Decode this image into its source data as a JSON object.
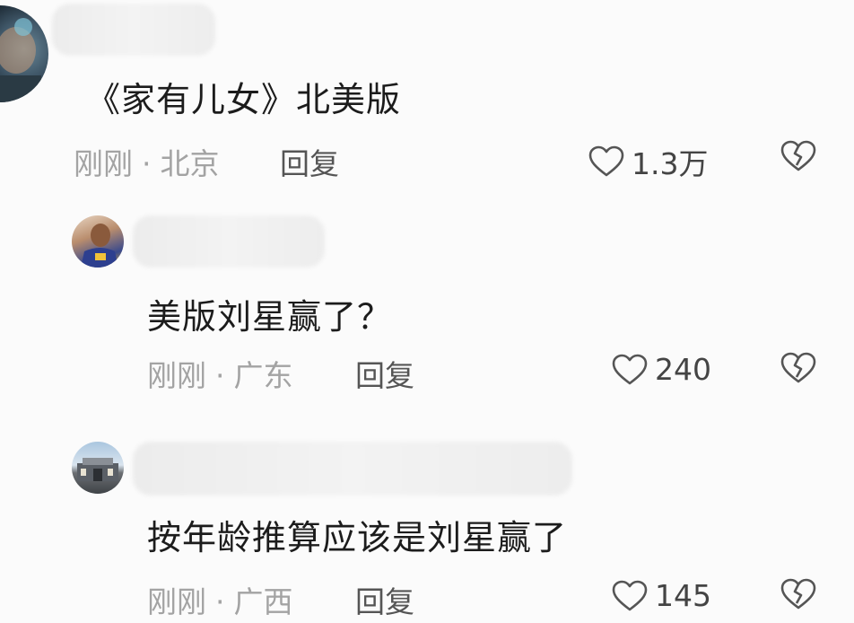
{
  "comments": [
    {
      "text": "《家有儿女》北美版",
      "time": "刚刚",
      "location": "北京",
      "reply_label": "回复",
      "likes": "1.3万"
    },
    {
      "text": "美版刘星赢了？",
      "time": "刚刚",
      "location": "广东",
      "reply_label": "回复",
      "likes": "240"
    },
    {
      "text": "按年龄推算应该是刘星赢了",
      "time": "刚刚",
      "location": "广西",
      "reply_label": "回复",
      "likes": "145"
    }
  ],
  "colors": {
    "background": "#fbfbfb",
    "meta_text": "#a3a3a3",
    "icon": "#555555"
  },
  "icons": {
    "like": "heart-icon",
    "dislike": "broken-heart-icon"
  }
}
